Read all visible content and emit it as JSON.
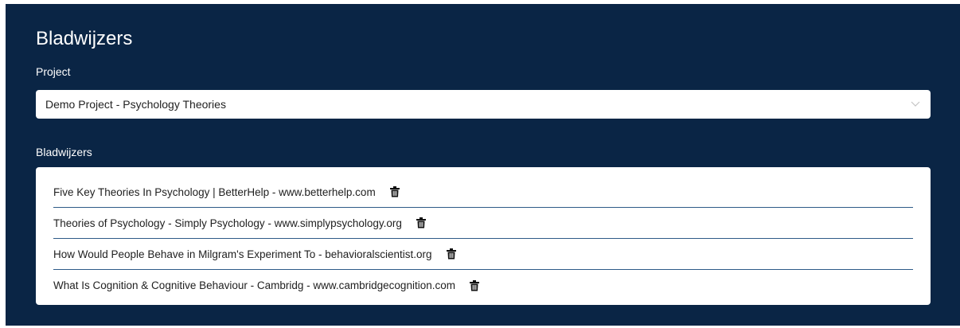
{
  "colors": {
    "panel_background": "#0a2545",
    "divider": "#2e5a88",
    "text_dark": "#1f1f1f"
  },
  "page": {
    "title": "Bladwijzers"
  },
  "project": {
    "label": "Project",
    "selected": "Demo Project - Psychology Theories",
    "dropdown_icon": "chevron-down-icon"
  },
  "bookmarks": {
    "label": "Bladwijzers",
    "delete_icon": "trash-icon",
    "items": [
      {
        "text": "Five Key Theories In Psychology | BetterHelp - www.betterhelp.com"
      },
      {
        "text": "Theories of Psychology - Simply Psychology - www.simplypsychology.org"
      },
      {
        "text": "How Would People Behave in Milgram's Experiment To - behavioralscientist.org"
      },
      {
        "text": "What Is Cognition & Cognitive Behaviour - Cambridg - www.cambridgecognition.com"
      }
    ]
  }
}
